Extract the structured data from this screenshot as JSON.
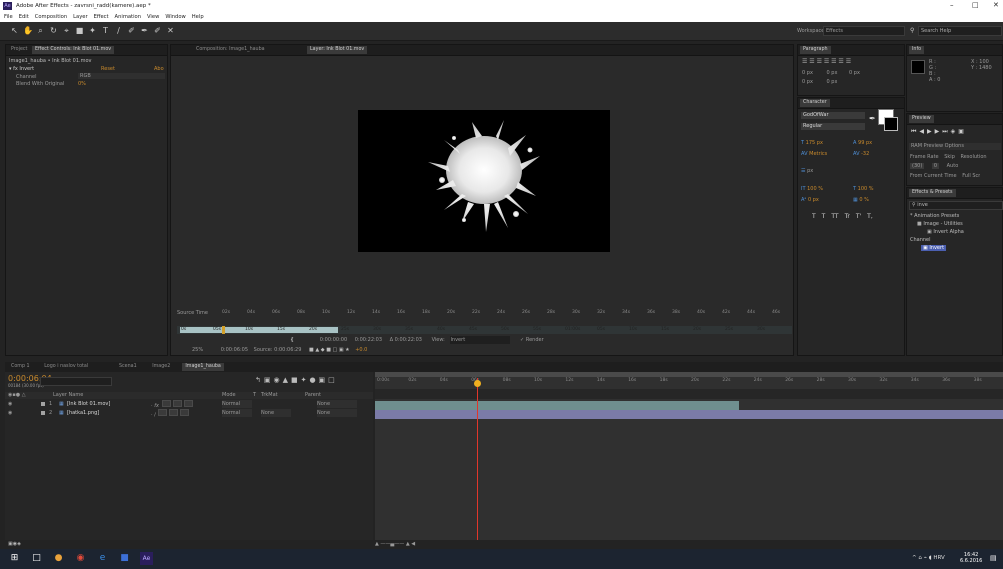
{
  "window": {
    "title": "Adobe After Effects - zavrsni_radd(kamere).aep *",
    "app_icon": "Ae",
    "controls": {
      "minimize": "–",
      "maximize": "□",
      "close": "✕"
    }
  },
  "menu": [
    "File",
    "Edit",
    "Composition",
    "Layer",
    "Effect",
    "Animation",
    "View",
    "Window",
    "Help"
  ],
  "toolbar": {
    "tools": [
      "↖",
      "✋",
      "⌕",
      "↻",
      "⌖",
      "■",
      "✦",
      "T",
      "∕",
      "✐",
      "✒",
      "✐",
      "✕"
    ],
    "workspace_label": "Workspace:",
    "workspace_value": "Effects",
    "search_help": "Search Help"
  },
  "left_panel": {
    "tabs": [
      "Project",
      "Effect Controls: Ink Blot 01.mov"
    ],
    "breadcrumb": "Image1_hauba • Ink Blot 01.mov",
    "effect": {
      "name": "Invert",
      "reset": "Reset",
      "about": "Abo"
    },
    "properties": [
      {
        "label": "Channel",
        "value": "RGB"
      },
      {
        "label": "Blend With Original",
        "value": "0%"
      }
    ]
  },
  "viewer": {
    "tabs": [
      "Composition: Image1_hauba",
      "Layer: Ink Blot 01.mov"
    ],
    "ruler": {
      "source_time_label": "Source Time",
      "ticks": [
        "02s",
        "04s",
        "06s",
        "08s",
        "10s",
        "12s",
        "14s",
        "16s",
        "18s",
        "20s",
        "22s",
        "24s",
        "26s",
        "28s",
        "30s",
        "32s",
        "34s",
        "36s",
        "38s",
        "40s",
        "42s",
        "44s",
        "46s"
      ],
      "ticks2": [
        "0s",
        "05s",
        "10s",
        "15s",
        "20s",
        "25s",
        "30s",
        "35s",
        "40s",
        "45s",
        "50s",
        "55s",
        "01:00s",
        "05s",
        "10s",
        "15s",
        "20s",
        "25s",
        "30s"
      ]
    },
    "footer": {
      "timecodes": [
        "0:00:00:00",
        "0:00:22:03",
        "Δ 0:00:22:03"
      ],
      "view_label": "View:",
      "view_value": "Invert",
      "render_label": "Render",
      "zoom": "25%",
      "current_time": "0:00:06:05",
      "source_label": "Source:",
      "source_time": "0:00:06:29",
      "offset": "+0.0"
    }
  },
  "right_panels": {
    "paragraph": {
      "tab": "Paragraph",
      "px_values": [
        "0 px",
        "0 px",
        "0 px",
        "0 px",
        "0 px"
      ]
    },
    "info": {
      "tab": "Info",
      "rgba": [
        "R :",
        "G :",
        "B :",
        "A : 0"
      ],
      "xy": [
        "X : 100",
        "Y : 1480"
      ]
    },
    "character": {
      "tab": "Character",
      "font": "GodOfWar",
      "style": "Regular",
      "size": "175 px",
      "leading": "99 px",
      "kerning": "Metrics",
      "tracking": "-32",
      "stroke": "px",
      "vscale": "100 %",
      "hscale": "100 %",
      "baseline": "0 px",
      "tsume": "0 %",
      "styles": [
        "T",
        "T",
        "TT",
        "Tr",
        "T'",
        "T,"
      ]
    },
    "preview": {
      "tab": "Preview",
      "ram_options": "RAM Preview Options",
      "frame_rate_label": "Frame Rate",
      "skip_label": "Skip",
      "resolution_label": "Resolution",
      "frame_rate": "(30)",
      "skip": "0",
      "resolution": "Auto",
      "from_current": "From Current Time",
      "full_screen": "Full Scr"
    },
    "effects_presets": {
      "tab": "Effects & Presets",
      "search": "inve",
      "tree": [
        "* Animation Presets",
        "Image - Utilities",
        "Invert Alpha",
        "Channel",
        "Invert"
      ]
    }
  },
  "timeline": {
    "tabs": [
      "Comp 1",
      "Logo i naslov total",
      "Scena1",
      "Image2",
      "Image1_hauba"
    ],
    "current_time": "0:00:06:04",
    "fps_info": "00184 (30.00 fps)",
    "columns": [
      "Layer Name",
      "Mode",
      "T",
      "TrkMat",
      "Parent"
    ],
    "layers": [
      {
        "num": "1",
        "name": "[Ink Blot 01.mov]",
        "mode": "Normal",
        "trkmat": "",
        "parent": "None"
      },
      {
        "num": "2",
        "name": "[hatka1.png]",
        "mode": "Normal",
        "trkmat": "None",
        "parent": "None"
      }
    ],
    "ruler_ticks": [
      "0:00s",
      "02s",
      "04s",
      "06s",
      "08s",
      "10s",
      "12s",
      "14s",
      "16s",
      "18s",
      "20s",
      "22s",
      "24s",
      "26s",
      "28s",
      "30s",
      "32s",
      "34s",
      "36s",
      "38s"
    ],
    "playhead_fraction": 0.163,
    "bar1_end_fraction": 0.579
  },
  "taskbar": {
    "icons": [
      "⊞",
      "□",
      "●",
      "◉",
      "e",
      "■",
      "Ae"
    ],
    "system": [
      "^",
      "⌂",
      "⌁",
      "◖",
      "HRV"
    ],
    "time": "16:42",
    "date": "6.6.2016"
  },
  "colors": {
    "accent_orange": "#c98a2c",
    "accent_blue": "#4f8fd6",
    "ae_purple": "#2a1e5c",
    "track_green": "#6f8f8f",
    "track_purple": "#7b7ba8"
  }
}
